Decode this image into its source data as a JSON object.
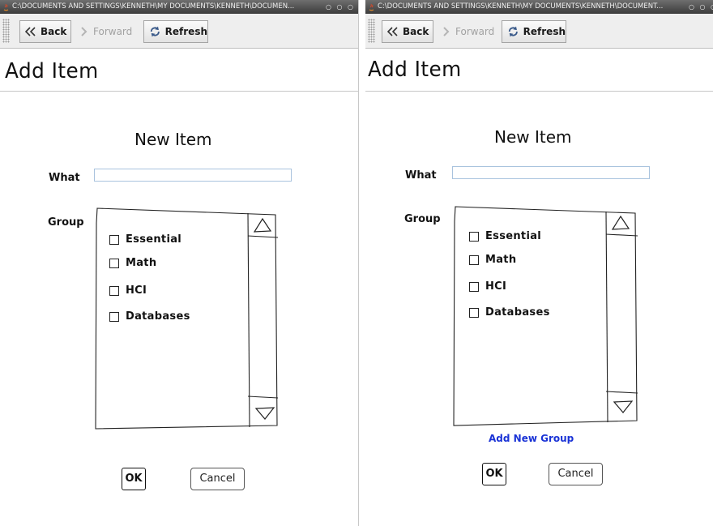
{
  "left": {
    "window_title": "C:\\DOCUMENTS AND SETTINGS\\KENNETH\\MY DOCUMENTS\\KENNETH\\DOCUMEN...",
    "window_dots": "○ ○ ○",
    "toolbar": {
      "back": "Back",
      "forward": "Forward",
      "refresh": "Refresh"
    },
    "heading": "Add Item",
    "form": {
      "title": "New Item",
      "what_label": "What",
      "what_value": "",
      "group_label": "Group",
      "groups": [
        "Essential",
        "Math",
        "HCI",
        "Databases"
      ],
      "ok": "OK",
      "cancel": "Cancel"
    }
  },
  "right": {
    "window_title": "C:\\DOCUMENTS AND SETTINGS\\KENNETH\\MY DOCUMENTS\\KENNETH\\DOCUMENT...",
    "window_dots": "○ ○ ○",
    "toolbar": {
      "back": "Back",
      "forward": "Forward",
      "refresh": "Refresh"
    },
    "heading": "Add Item",
    "form": {
      "title": "New Item",
      "what_label": "What",
      "what_value": "",
      "group_label": "Group",
      "groups": [
        "Essential",
        "Math",
        "HCI",
        "Databases"
      ],
      "add_group_link": "Add New Group",
      "ok": "OK",
      "cancel": "Cancel"
    }
  }
}
